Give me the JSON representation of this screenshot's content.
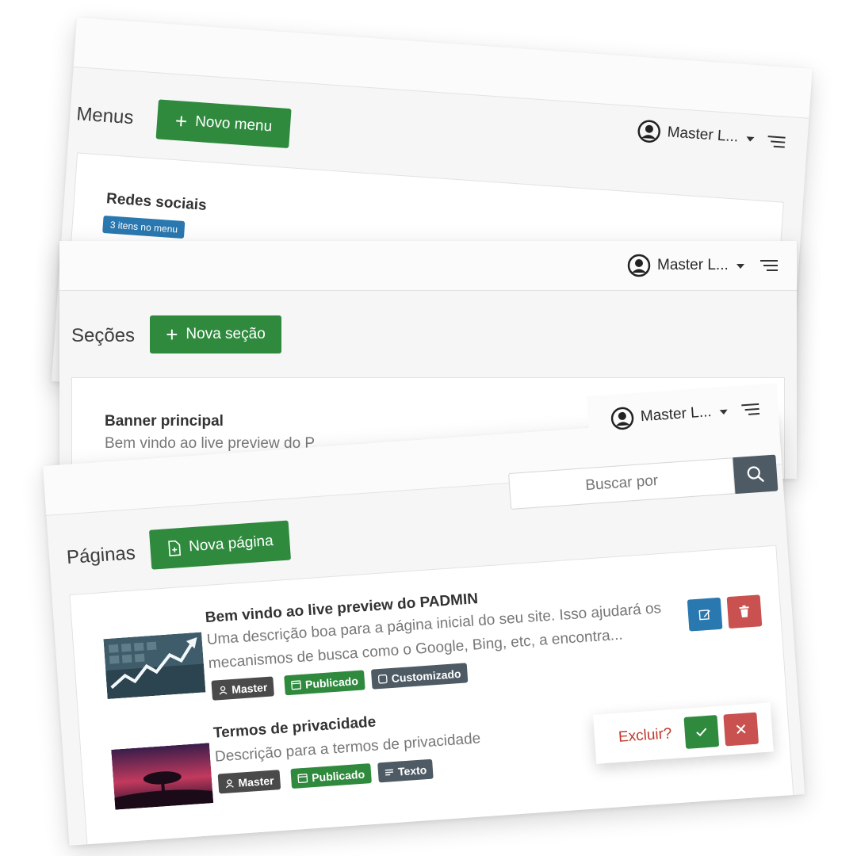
{
  "user": {
    "name": "Master L..."
  },
  "menus": {
    "title": "Menus",
    "new_button": "Novo menu",
    "items": [
      {
        "name": "Redes sociais",
        "badge": "3 itens no menu"
      }
    ]
  },
  "secoes": {
    "title": "Seções",
    "new_button": "Nova seção",
    "items": [
      {
        "name": "Banner principal",
        "description": "Bem vindo ao live preview do P"
      }
    ]
  },
  "paginas": {
    "title": "Páginas",
    "new_button": "Nova página",
    "search_placeholder": "Buscar por",
    "items": [
      {
        "title": "Bem vindo ao live preview do PADMIN",
        "desc_line1": "Uma descrição boa para a página inicial do seu site. Isso ajudará os",
        "desc_line2": "mecanismos de busca como o Google, Bing, etc, a encontra...",
        "tags": [
          "Master",
          "Publicado",
          "Customizado"
        ]
      },
      {
        "title": "Termos de privacidade",
        "desc_line1": "Descrição para a termos de privacidade",
        "tags": [
          "Master",
          "Publicado",
          "Texto"
        ]
      }
    ],
    "confirm": {
      "question": "Excluir?"
    }
  },
  "colors": {
    "primary_green": "#2f8a3e",
    "badge_blue": "#2a78b0",
    "edit_blue": "#2a78b0",
    "delete_red": "#c9514f",
    "slate": "#4e5b65",
    "excluir_text": "#c0392b"
  }
}
